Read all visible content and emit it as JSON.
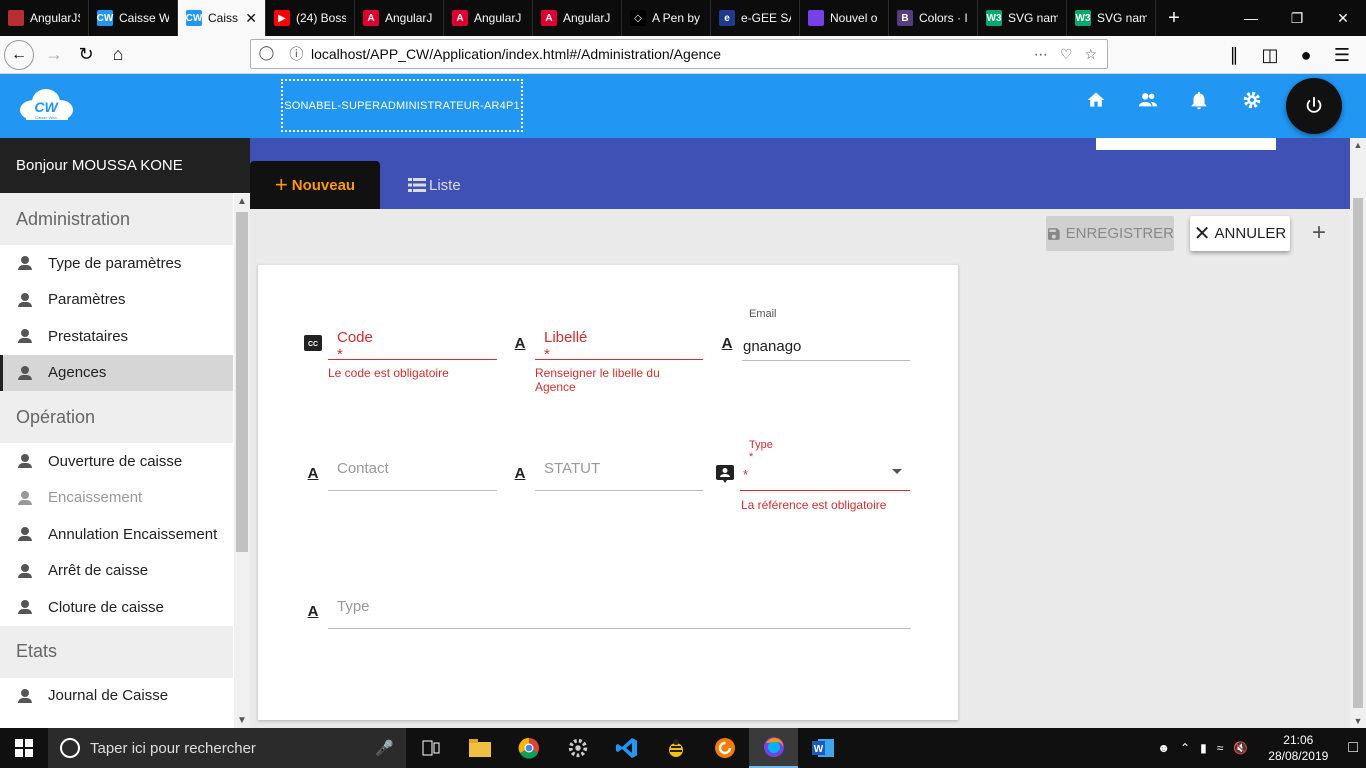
{
  "browser": {
    "tabs": [
      {
        "title": "AngularJS M",
        "icon": "angularjs-icon",
        "active": false
      },
      {
        "title": "Caisse W",
        "icon": "caisse-web-icon",
        "active": false
      },
      {
        "title": "Caiss",
        "icon": "caisse-web-icon",
        "active": true
      },
      {
        "title": "(24) Boss",
        "icon": "youtube-icon",
        "active": false
      },
      {
        "title": "AngularJ",
        "icon": "angular-icon",
        "active": false
      },
      {
        "title": "AngularJ",
        "icon": "angular-icon",
        "active": false
      },
      {
        "title": "AngularJ",
        "icon": "angular-icon",
        "active": false
      },
      {
        "title": "A Pen by",
        "icon": "codepen-icon",
        "active": false
      },
      {
        "title": "e-GEE SA",
        "icon": "egee-icon",
        "active": false
      },
      {
        "title": "Nouvel o",
        "icon": "firefox-icon",
        "active": false
      },
      {
        "title": "Colors · I",
        "icon": "bootstrap-icon",
        "active": false
      },
      {
        "title": "SVG nam",
        "icon": "w3schools-icon",
        "active": false
      },
      {
        "title": "SVG nam",
        "icon": "w3schools-icon",
        "active": false
      }
    ],
    "url": "localhost/APP_CW/Application/index.html#/Administration/Agence",
    "colors": {
      "tabbar": "#0c0c0d",
      "active_tab": "#f9f9fa"
    }
  },
  "app": {
    "logo_text": "CW",
    "logo_subtext": "Caisse Web",
    "user_role": "SONABEL-SUPERADMINISTRATEUR-AR4P1",
    "header_icons": [
      "home-icon",
      "people-icon",
      "bell-icon",
      "gear-icon"
    ],
    "colors": {
      "header": "#2196f3",
      "toolbar": "#3f51b5",
      "accent": "#ff9800",
      "error": "#d32f2f"
    }
  },
  "sidebar": {
    "greeting": "Bonjour MOUSSA KONE",
    "sections": [
      {
        "title": "Administration",
        "items": [
          {
            "label": "Type de paramètres",
            "state": "normal"
          },
          {
            "label": "Paramètres",
            "state": "normal"
          },
          {
            "label": "Prestataires",
            "state": "normal"
          },
          {
            "label": "Agences",
            "state": "selected"
          }
        ]
      },
      {
        "title": "Opération",
        "items": [
          {
            "label": "Ouverture de caisse",
            "state": "normal"
          },
          {
            "label": "Encaissement",
            "state": "disabled"
          },
          {
            "label": "Annulation Encaissement",
            "state": "normal"
          },
          {
            "label": "Arrêt de caisse",
            "state": "normal"
          },
          {
            "label": "Cloture de caisse",
            "state": "normal"
          }
        ]
      },
      {
        "title": "Etats",
        "items": [
          {
            "label": "Journal de Caisse",
            "state": "normal"
          }
        ]
      }
    ]
  },
  "tabs": {
    "new_label": "Nouveau",
    "list_label": "Liste"
  },
  "actions": {
    "save_label": "ENREGISTRER",
    "cancel_label": "ANNULER"
  },
  "form": {
    "code": {
      "label": "Code",
      "required": "*",
      "error": "Le code est obligatoire"
    },
    "libelle": {
      "label": "Libellé",
      "required": "*",
      "error": "Renseigner le libelle du Agence"
    },
    "email": {
      "label": "Email",
      "value": "gnanago"
    },
    "contact": {
      "placeholder": "Contact"
    },
    "statut": {
      "placeholder": "STATUT"
    },
    "type_select": {
      "label": "Type",
      "required": "*",
      "value": "*",
      "error": "La référence est obligatoire"
    },
    "type_text": {
      "placeholder": "Type"
    }
  },
  "taskbar": {
    "search_placeholder": "Taper ici pour rechercher",
    "time": "21:06",
    "date": "28/08/2019"
  }
}
